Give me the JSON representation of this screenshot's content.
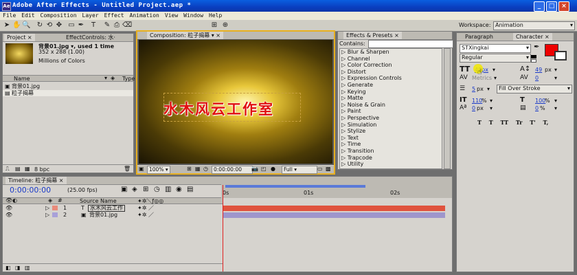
{
  "window": {
    "title": "Adobe After Effects - Untitled Project.aep *",
    "min": "_",
    "max": "□",
    "close": "×"
  },
  "menu": [
    "File",
    "Edit",
    "Composition",
    "Layer",
    "Effect",
    "Animation",
    "View",
    "Window",
    "Help"
  ],
  "workspace": {
    "label": "Workspace:",
    "value": "Animation"
  },
  "project": {
    "tab_project": "Project",
    "tab_effect_controls": "EffectControls: 水·",
    "item_title": "背景01.jpg ▾, used 1 time",
    "item_dims": "352 x 288 (1.00)",
    "item_colors": "Millions of Colors",
    "col_name": "Name",
    "col_type": "Type",
    "items": [
      "背景01.jpg",
      "粒子揭幕"
    ],
    "bpc": "8 bpc"
  },
  "composition": {
    "tab": "Composition: 粒子揭幕",
    "text": "水木风云工作室",
    "zoom": "100%",
    "timecode": "0:00:00:00",
    "resolution": "Full"
  },
  "effects": {
    "tab": "Effects & Presets",
    "contains_label": "Contains:",
    "items": [
      "Blur & Sharpen",
      "Channel",
      "Color Correction",
      "Distort",
      "Expression Controls",
      "Generate",
      "Keying",
      "Matte",
      "Noise & Grain",
      "Paint",
      "Perspective",
      "Simulation",
      "Stylize",
      "Text",
      "Time",
      "Transition",
      "Trapcode",
      "Utility"
    ]
  },
  "character": {
    "tab_paragraph": "Paragraph",
    "tab_character": "Character",
    "font": "STXingkai",
    "style": "Regular",
    "size": "48px",
    "leading": "49",
    "leading_unit": "px",
    "kerning": "Metrics",
    "tracking": "0",
    "stroke_width": "5",
    "stroke_unit": "px",
    "stroke_type": "Fill Over Stroke",
    "vscale": "110",
    "hscale": "100",
    "pct": "%",
    "baseline": "0",
    "tsume": "0",
    "fill_color": "#ee0000",
    "stroke_color": "#ffffff",
    "styles": [
      "T",
      "T",
      "TT",
      "Tr",
      "T'",
      "T,"
    ]
  },
  "timeline": {
    "tab": "Timeline: 粒子揭幕",
    "timecode": "0:00:00:00",
    "fps": "(25.00 fps)",
    "col_source": "Source Name",
    "ruler": [
      "0s",
      "01s",
      "02s"
    ],
    "layers": [
      {
        "num": "1",
        "type": "T",
        "name": "水木风云工作",
        "color": "#e88a7a",
        "bar": "#e0533e"
      },
      {
        "num": "2",
        "type": "",
        "name": "背景01.jpg",
        "color": "#a8a0d8",
        "bar": "#9e96cc"
      }
    ]
  }
}
